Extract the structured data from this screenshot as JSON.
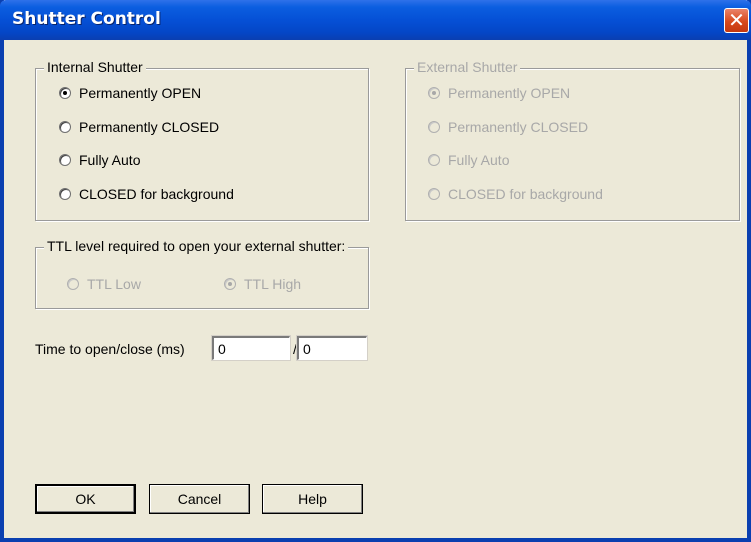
{
  "window": {
    "title": "Shutter Control",
    "close_glyph": "✕"
  },
  "internal_shutter": {
    "legend": "Internal Shutter",
    "options": [
      {
        "label": "Permanently OPEN",
        "checked": true
      },
      {
        "label": "Permanently CLOSED",
        "checked": false
      },
      {
        "label": "Fully Auto",
        "checked": false
      },
      {
        "label": "CLOSED for background",
        "checked": false
      }
    ]
  },
  "external_shutter": {
    "legend": "External Shutter",
    "enabled": false,
    "options": [
      {
        "label": "Permanently OPEN",
        "checked": true
      },
      {
        "label": "Permanently CLOSED",
        "checked": false
      },
      {
        "label": "Fully Auto",
        "checked": false
      },
      {
        "label": "CLOSED for background",
        "checked": false
      }
    ]
  },
  "ttl": {
    "legend": "TTL level required to open your external shutter:",
    "enabled": false,
    "low_label": "TTL Low",
    "high_label": "TTL High",
    "selected": "high"
  },
  "timing": {
    "label": "Time to open/close (ms)",
    "open_value": "0",
    "separator": "/",
    "close_value": "0"
  },
  "buttons": {
    "ok": "OK",
    "cancel": "Cancel",
    "help": "Help"
  },
  "colors": {
    "titlebar": "#0550d6",
    "dialog_bg": "#ece9d8",
    "close_button": "#d8491c",
    "disabled_text": "#a8a8a8"
  }
}
